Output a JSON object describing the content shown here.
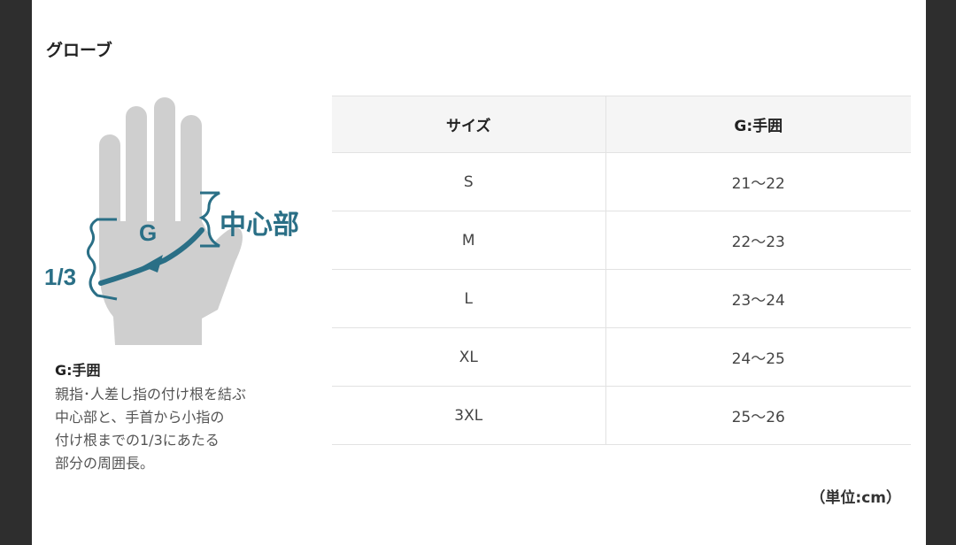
{
  "modal": {
    "title": "グローブ"
  },
  "diagram": {
    "label_g": "G",
    "label_center": "中心部",
    "label_third": "1/3"
  },
  "description": {
    "title": "G:手囲",
    "lines": [
      "親指･人差し指の付け根を結ぶ",
      "中心部と、手首から小指の",
      "付け根までの1/3にあたる",
      "部分の周囲長。"
    ]
  },
  "table": {
    "headers": [
      "サイズ",
      "G:手囲"
    ],
    "rows": [
      [
        "S",
        "21～22"
      ],
      [
        "M",
        "22～23"
      ],
      [
        "L",
        "23～24"
      ],
      [
        "XL",
        "24～25"
      ],
      [
        "3XL",
        "25～26"
      ]
    ]
  },
  "unit_note": "（単位:cm）",
  "colors": {
    "hand": "#cfcfcf",
    "accent": "#2a6f86",
    "header_bg": "#f5f5f5",
    "backdrop": "#2e2e2e"
  }
}
